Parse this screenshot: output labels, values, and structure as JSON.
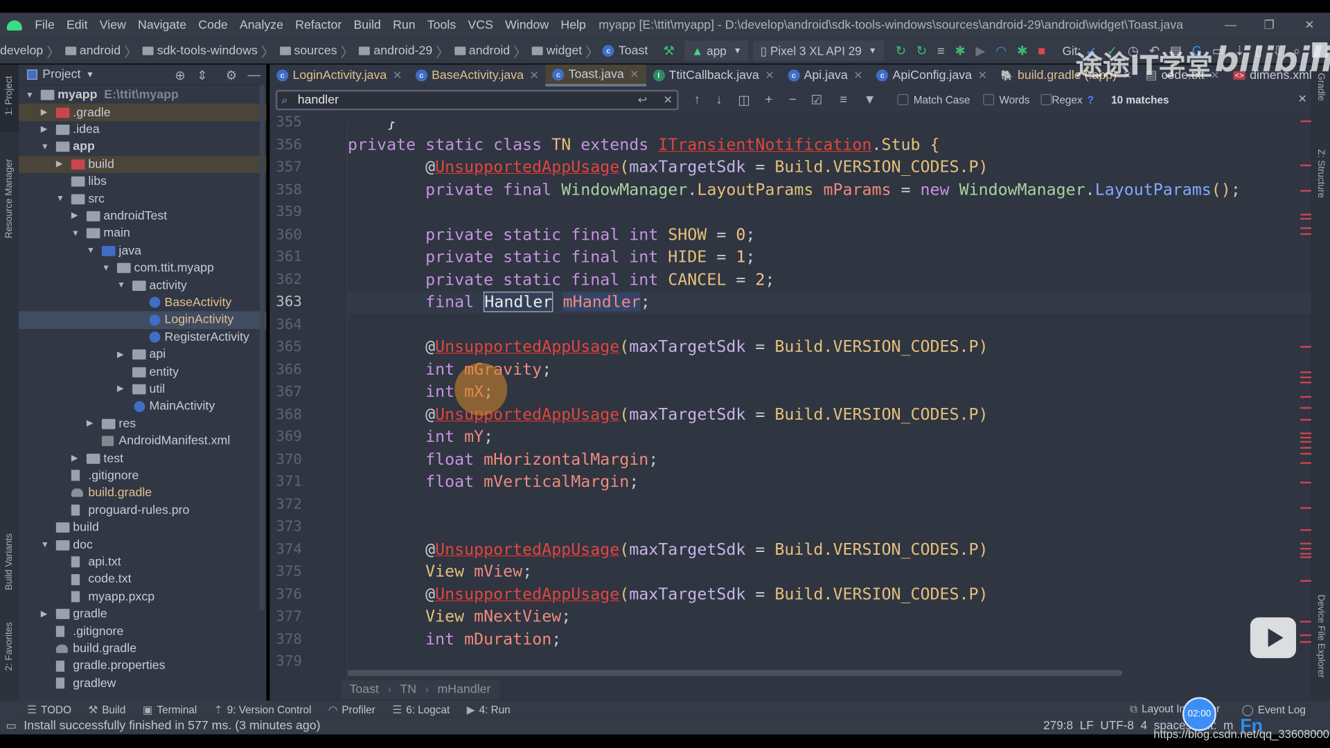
{
  "window": {
    "title": "myapp [E:\\ttit\\myapp] - D:\\develop\\android\\sdk-tools-windows\\sources\\android-29\\android\\widget\\Toast.java",
    "menu": [
      "File",
      "Edit",
      "View",
      "Navigate",
      "Code",
      "Analyze",
      "Refactor",
      "Build",
      "Run",
      "Tools",
      "VCS",
      "Window",
      "Help"
    ]
  },
  "breadcrumb": [
    "develop",
    "android",
    "sdk-tools-windows",
    "sources",
    "android-29",
    "android",
    "widget",
    "Toast"
  ],
  "toolbar": {
    "run_config": "app",
    "device": "Pixel 3 XL API 29",
    "git_label": "Git:"
  },
  "tool_strips": {
    "left": [
      "1: Project",
      "Resource Manager",
      "Build Variants",
      "2: Favorites"
    ],
    "right": [
      "Gradle",
      "Z: Structure",
      "Device File Explorer"
    ]
  },
  "project": {
    "title": "Project",
    "tree": [
      {
        "d": 0,
        "a": "open",
        "i": "module",
        "t": "myapp",
        "s": "bold",
        "extra": "E:\\ttit\\myapp"
      },
      {
        "d": 1,
        "a": "closed",
        "i": "folder-red",
        "t": ".gradle",
        "row": "hl"
      },
      {
        "d": 1,
        "a": "closed",
        "i": "folder",
        "t": ".idea"
      },
      {
        "d": 1,
        "a": "open",
        "i": "module",
        "t": "app",
        "s": "bold"
      },
      {
        "d": 2,
        "a": "closed",
        "i": "folder-red",
        "t": "build",
        "row": "hl"
      },
      {
        "d": 2,
        "a": "none",
        "i": "folder",
        "t": "libs"
      },
      {
        "d": 2,
        "a": "open",
        "i": "folder",
        "t": "src"
      },
      {
        "d": 3,
        "a": "closed",
        "i": "folder",
        "t": "androidTest"
      },
      {
        "d": 3,
        "a": "open",
        "i": "folder",
        "t": "main"
      },
      {
        "d": 4,
        "a": "open",
        "i": "folder-blue",
        "t": "java"
      },
      {
        "d": 5,
        "a": "open",
        "i": "package",
        "t": "com.ttit.myapp"
      },
      {
        "d": 6,
        "a": "open",
        "i": "package",
        "t": "activity"
      },
      {
        "d": 7,
        "a": "none",
        "i": "class",
        "t": "BaseActivity",
        "s": "yellow"
      },
      {
        "d": 7,
        "a": "none",
        "i": "class",
        "t": "LoginActivity",
        "s": "yellow",
        "row": "sel"
      },
      {
        "d": 7,
        "a": "none",
        "i": "class",
        "t": "RegisterActivity"
      },
      {
        "d": 6,
        "a": "closed",
        "i": "package",
        "t": "api"
      },
      {
        "d": 6,
        "a": "none",
        "i": "package",
        "t": "entity"
      },
      {
        "d": 6,
        "a": "closed",
        "i": "package",
        "t": "util"
      },
      {
        "d": 6,
        "a": "none",
        "i": "class",
        "t": "MainActivity"
      },
      {
        "d": 4,
        "a": "closed",
        "i": "folder",
        "t": "res"
      },
      {
        "d": 4,
        "a": "none",
        "i": "manifest",
        "t": "AndroidManifest.xml"
      },
      {
        "d": 3,
        "a": "closed",
        "i": "folder",
        "t": "test"
      },
      {
        "d": 2,
        "a": "none",
        "i": "file",
        "t": ".gitignore"
      },
      {
        "d": 2,
        "a": "none",
        "i": "gradle",
        "t": "build.gradle",
        "s": "yellow"
      },
      {
        "d": 2,
        "a": "none",
        "i": "file",
        "t": "proguard-rules.pro"
      },
      {
        "d": 1,
        "a": "none",
        "i": "folder",
        "t": "build"
      },
      {
        "d": 1,
        "a": "open",
        "i": "folder",
        "t": "doc"
      },
      {
        "d": 2,
        "a": "none",
        "i": "file",
        "t": "api.txt"
      },
      {
        "d": 2,
        "a": "none",
        "i": "file",
        "t": "code.txt"
      },
      {
        "d": 2,
        "a": "none",
        "i": "file",
        "t": "myapp.pxcp"
      },
      {
        "d": 1,
        "a": "closed",
        "i": "folder",
        "t": "gradle"
      },
      {
        "d": 1,
        "a": "none",
        "i": "file",
        "t": ".gitignore"
      },
      {
        "d": 1,
        "a": "none",
        "i": "gradle",
        "t": "build.gradle"
      },
      {
        "d": 1,
        "a": "none",
        "i": "file",
        "t": "gradle.properties"
      },
      {
        "d": 1,
        "a": "none",
        "i": "file",
        "t": "gradlew"
      }
    ]
  },
  "tabs": [
    {
      "label": "LoginActivity.java",
      "icon": "class",
      "style": "yellow"
    },
    {
      "label": "BaseActivity.java",
      "icon": "class",
      "style": "yellow"
    },
    {
      "label": "Toast.java",
      "icon": "class",
      "active": true
    },
    {
      "label": "TtitCallback.java",
      "icon": "interface"
    },
    {
      "label": "Api.java",
      "icon": "class"
    },
    {
      "label": "ApiConfig.java",
      "icon": "class"
    },
    {
      "label": "build.gradle (:app)",
      "icon": "gradle",
      "style": "yellow"
    },
    {
      "label": "code.txt",
      "icon": "file"
    },
    {
      "label": "dimens.xml",
      "icon": "xml"
    }
  ],
  "find": {
    "query": "handler",
    "match_case": "Match Case",
    "words": "Words",
    "regex": "Regex",
    "help": "?",
    "matches": "10 matches",
    "match_case_checked": false,
    "words_checked": false,
    "regex_checked": false
  },
  "code": {
    "first_line": 355,
    "current_line": 363,
    "lines": [
      [
        [
          "pl",
          "    }"
        ]
      ],
      [
        [
          "kw",
          "private static class "
        ],
        [
          "ty",
          "TN"
        ],
        [
          "kw",
          " extends "
        ],
        [
          "err",
          "ITransientNotification"
        ],
        [
          "pl",
          "."
        ],
        [
          "ty",
          "Stub"
        ],
        [
          "par",
          " {"
        ]
      ],
      [
        [
          "pl",
          "        @"
        ],
        [
          "err",
          "UnsupportedAppUsage"
        ],
        [
          "par",
          "("
        ],
        [
          "prm",
          "maxTargetSdk"
        ],
        [
          "pl",
          " = "
        ],
        [
          "ty",
          "Build.VERSION_CODES.P"
        ],
        [
          "par",
          ")"
        ]
      ],
      [
        [
          "kw",
          "        private final "
        ],
        [
          "cls",
          "WindowManager"
        ],
        [
          "pl",
          "."
        ],
        [
          "ty",
          "LayoutParams "
        ],
        [
          "fld",
          "mParams"
        ],
        [
          "pl",
          " = "
        ],
        [
          "kw",
          "new "
        ],
        [
          "cls",
          "WindowManager"
        ],
        [
          "pl",
          "."
        ],
        [
          "fn",
          "LayoutParams"
        ],
        [
          "par",
          "()"
        ],
        [
          "pl",
          ";"
        ]
      ],
      [],
      [
        [
          "kw",
          "        private static final int "
        ],
        [
          "ty",
          "SHOW"
        ],
        [
          "pl",
          " = "
        ],
        [
          "num",
          "0"
        ],
        [
          "pl",
          ";"
        ]
      ],
      [
        [
          "kw",
          "        private static final int "
        ],
        [
          "ty",
          "HIDE"
        ],
        [
          "pl",
          " = "
        ],
        [
          "num",
          "1"
        ],
        [
          "pl",
          ";"
        ]
      ],
      [
        [
          "kw",
          "        private static final int "
        ],
        [
          "ty",
          "CANCEL"
        ],
        [
          "pl",
          " = "
        ],
        [
          "num",
          "2"
        ],
        [
          "pl",
          ";"
        ]
      ],
      [
        [
          "kw",
          "        final "
        ],
        [
          "match",
          "Handler"
        ],
        [
          "pl",
          " "
        ],
        [
          "fld match2",
          "mHandler"
        ],
        [
          "pl",
          ";"
        ]
      ],
      [],
      [
        [
          "pl",
          "        @"
        ],
        [
          "err",
          "UnsupportedAppUsage"
        ],
        [
          "par",
          "("
        ],
        [
          "prm",
          "maxTargetSdk"
        ],
        [
          "pl",
          " = "
        ],
        [
          "ty",
          "Build.VERSION_CODES.P"
        ],
        [
          "par",
          ")"
        ]
      ],
      [
        [
          "kw",
          "        int "
        ],
        [
          "fld",
          "mGravity"
        ],
        [
          "pl",
          ";"
        ]
      ],
      [
        [
          "kw",
          "        int "
        ],
        [
          "fld",
          "mX"
        ],
        [
          "pl",
          ";"
        ]
      ],
      [
        [
          "pl",
          "        @"
        ],
        [
          "err",
          "UnsupportedAppUsage"
        ],
        [
          "par",
          "("
        ],
        [
          "prm",
          "maxTargetSdk"
        ],
        [
          "pl",
          " = "
        ],
        [
          "ty",
          "Build.VERSION_CODES.P"
        ],
        [
          "par",
          ")"
        ]
      ],
      [
        [
          "kw",
          "        int "
        ],
        [
          "fld",
          "mY"
        ],
        [
          "pl",
          ";"
        ]
      ],
      [
        [
          "kw",
          "        float "
        ],
        [
          "fld",
          "mHorizontalMargin"
        ],
        [
          "pl",
          ";"
        ]
      ],
      [
        [
          "kw",
          "        float "
        ],
        [
          "fld",
          "mVerticalMargin"
        ],
        [
          "pl",
          ";"
        ]
      ],
      [],
      [],
      [
        [
          "pl",
          "        @"
        ],
        [
          "err",
          "UnsupportedAppUsage"
        ],
        [
          "par",
          "("
        ],
        [
          "prm",
          "maxTargetSdk"
        ],
        [
          "pl",
          " = "
        ],
        [
          "ty",
          "Build.VERSION_CODES.P"
        ],
        [
          "par",
          ")"
        ]
      ],
      [
        [
          "ty",
          "        View "
        ],
        [
          "fld",
          "mView"
        ],
        [
          "pl",
          ";"
        ]
      ],
      [
        [
          "pl",
          "        @"
        ],
        [
          "err",
          "UnsupportedAppUsage"
        ],
        [
          "par",
          "("
        ],
        [
          "prm",
          "maxTargetSdk"
        ],
        [
          "pl",
          " = "
        ],
        [
          "ty",
          "Build.VERSION_CODES.P"
        ],
        [
          "par",
          ")"
        ]
      ],
      [
        [
          "ty",
          "        View "
        ],
        [
          "fld",
          "mNextView"
        ],
        [
          "pl",
          ";"
        ]
      ],
      [
        [
          "kw",
          "        int "
        ],
        [
          "fld",
          "mDuration"
        ],
        [
          "pl",
          ";"
        ]
      ],
      []
    ]
  },
  "editor_breadcrumb": [
    "Toast",
    "TN",
    "mHandler"
  ],
  "bottom_tools": [
    "TODO",
    "Build",
    "Terminal",
    "9: Version Control",
    "Profiler",
    "6: Logcat",
    "4: Run"
  ],
  "bottom_right_tools": [
    "Layout Inspector",
    "Event Log"
  ],
  "status": {
    "message": "Install successfully finished in 577 ms. (3 minutes ago)",
    "position": "279:8",
    "line_sep": "LF",
    "encoding": "UTF-8",
    "indent": "4 spaces",
    "fmt": "Git: m"
  },
  "overlay": {
    "watermark": "途途IT学堂",
    "logo": "bilibili",
    "timer": "02:00",
    "url": "https://blog.csdn.net/qq_33608000",
    "ime": "Fn"
  }
}
